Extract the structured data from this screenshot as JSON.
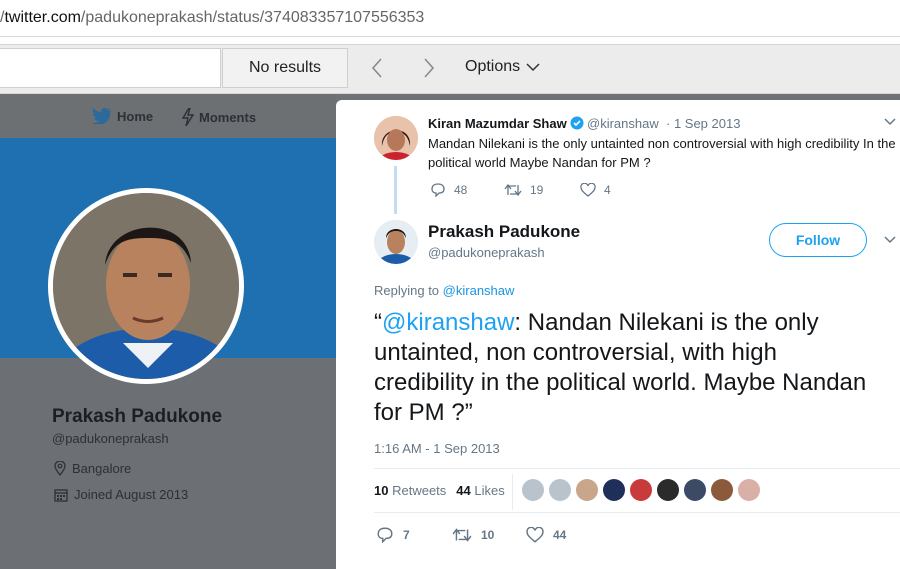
{
  "browser": {
    "url_prefix": "/",
    "url_domain": "twitter.com",
    "url_path": "/padukoneprakash/status/374083357107556353"
  },
  "findbar": {
    "search_value": "",
    "results_label": "No results",
    "options_label": "Options"
  },
  "profile": {
    "nav": {
      "home": "Home",
      "moments": "Moments"
    },
    "name": "Prakash Padukone",
    "handle": "@padukoneprakash",
    "location": "Bangalore",
    "joined": "Joined August 2013"
  },
  "parent_tweet": {
    "author_name": "Kiran Mazumdar Shaw",
    "author_handle": "@kiranshaw",
    "date": "· 1 Sep 2013",
    "text": "Mandan Nilekani is the only untainted non controversial with high credibility   In the political world Maybe Nandan for PM ?",
    "replies": "48",
    "retweets": "19",
    "likes": "4"
  },
  "tweet": {
    "author_name": "Prakash Padukone",
    "author_handle": "@padukoneprakash",
    "follow_label": "Follow",
    "replying_prefix": "Replying to",
    "replying_to": "@kiranshaw",
    "text_open": "“",
    "text_mention": "@kiranshaw",
    "text_body": ": Nandan Nilekani is the only untainted, non controversial, with high credibility in the political world. Maybe Nandan for PM ?”",
    "timestamp": "1:16 AM - 1 Sep 2013",
    "retweet_count": "10",
    "retweet_label": "Retweets",
    "like_count": "44",
    "like_label": "Likes",
    "actions": {
      "replies": "7",
      "retweets": "10",
      "likes": "44"
    }
  },
  "likers": [
    {
      "color": "#b9c3cc"
    },
    {
      "color": "#b9c3cc"
    },
    {
      "color": "#c9a58a"
    },
    {
      "color": "#1f2f5a"
    },
    {
      "color": "#c93a3a"
    },
    {
      "color": "#2b2b2b"
    },
    {
      "color": "#3c4a66"
    },
    {
      "color": "#8a5a3a"
    },
    {
      "color": "#d8b0a8"
    }
  ],
  "colors": {
    "accent": "#1da1f2",
    "banner": "#1e70b0",
    "muted": "#657786"
  }
}
